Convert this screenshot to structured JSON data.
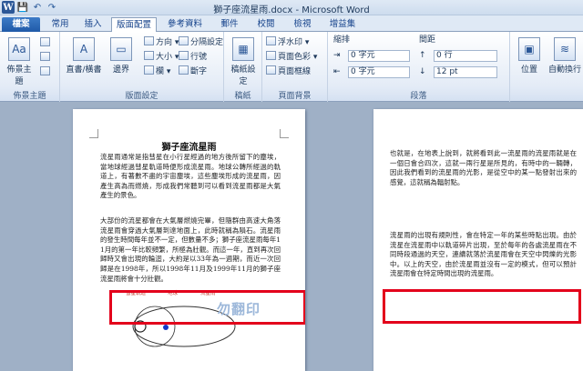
{
  "window": {
    "title": "獅子座流星雨.docx - Microsoft Word"
  },
  "qat": {
    "save": "💾",
    "undo": "↶",
    "redo": "↷"
  },
  "tabs": [
    {
      "label": "檔案"
    },
    {
      "label": "常用"
    },
    {
      "label": "插入"
    },
    {
      "label": "版面配置"
    },
    {
      "label": "參考資料"
    },
    {
      "label": "郵件"
    },
    {
      "label": "校閱"
    },
    {
      "label": "檢視"
    },
    {
      "label": "增益集"
    }
  ],
  "ribbon": {
    "theme_group": {
      "label": "佈景主題",
      "themes": "佈景主題"
    },
    "page_setup": {
      "label": "版面設定",
      "margins": "邊界",
      "orientation_text": "直書/橫書",
      "direction": "方向",
      "size": "大小",
      "columns": "欄",
      "breaks": "分隔設定",
      "line_numbers": "行號",
      "hyphenation": "斷字"
    },
    "draft_group": {
      "label": "稿紙",
      "draft": "稿紙設定"
    },
    "background": {
      "label": "頁面背景",
      "watermark": "浮水印",
      "page_color": "頁面色彩",
      "page_borders": "頁面框線"
    },
    "paragraph": {
      "label": "段落",
      "indent": "縮排",
      "spacing": "間距",
      "left_value": "0 字元",
      "right_value": "0 字元",
      "before_value": "0 行",
      "after_value": "12 pt"
    },
    "arrange": {
      "position": "位置",
      "wrap": "自動換行"
    }
  },
  "document": {
    "title": "獅子座流星雨",
    "left_paras": [
      "流星雨通常是指彗星在小行星經過的地方後所留下的塵埃，當地球經過彗星軌道時便形成流星雨。地球公轉所經過的軌道上，有著數不盡的宇宙塵埃，這些塵埃形成的流星雨，因產生高為而燃燒，形成我們常聽到可以看到流星雨都是大氣產生的景色。",
      "大部份的流星都會在大氣層燃燒完畢，但隨群由高速大角落流星雨會穿過大氣層到達地面上，此時就稱為隕石。流星雨的發生時間每年並不一定，但數量不多；獅子座流星雨每年11月的第一年比較頻繁，所極為壯觀。而這一年，直到再次回歸時又會出現的輪迴，大約是以33年為一週期，而近一次回歸是在1998年，所以1998年11月及1999年11月的獅子座流星雨將會十分壯觀。"
    ],
    "right_paras": [
      "也就是，在地表上說到，就將看到此一流星雨的流星雨就是在一個日會合四次，這就一兩行星是所見的，有時中的一輛轉，因此我們看到的流星雨的光影，是從空中的某一點發射出來的感覺，這就稱為輻射點。",
      "流星雨的出現有規則性，會在特定一年的某些時點出現。由於流星在流星雨中以軌道碎片出現，至於每年的各處流星雨在不同時段通過的天空，連續就落於流星雨會在天空中閃爍的光影中。以上的天空，由於流星雨並沒有一定的模式，但可以預計流星雨會在特定時間出現的流星雨。"
    ],
    "figure_captions": [
      "彗星軌道",
      "地球",
      "流星雨"
    ],
    "watermark_text": "勿翻印"
  }
}
